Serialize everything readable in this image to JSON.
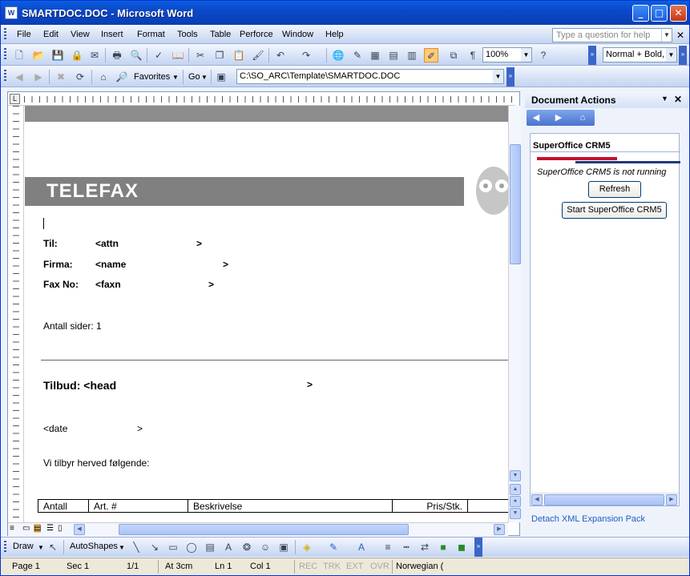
{
  "window": {
    "title": "SMARTDOC.DOC - Microsoft Word"
  },
  "menu": {
    "items": [
      "File",
      "Edit",
      "View",
      "Insert",
      "Format",
      "Tools",
      "Table",
      "Perforce",
      "Window",
      "Help"
    ],
    "ask_placeholder": "Type a question for help"
  },
  "toolbar": {
    "zoom": "100%",
    "style": "Normal + Bold,"
  },
  "web": {
    "favorites": "Favorites",
    "go": "Go",
    "address": "C:\\SO_ARC\\Template\\SMARTDOC.DOC"
  },
  "doc": {
    "banner": "TELEFAX",
    "til_label": "Til:",
    "til_value": "<attn",
    "til_close": ">",
    "firma_label": "Firma:",
    "firma_value": "<name",
    "firma_close": ">",
    "fax_label": "Fax No:",
    "fax_value": "<faxn",
    "fax_close": ">",
    "pages": "Antall sider: 1",
    "tilbud": "Tilbud: <head",
    "tilbud_close": ">",
    "date": "<date",
    "date_close": ">",
    "offer": "Vi tilbyr herved følgende:",
    "table_headers": [
      "Antall",
      "Art. #",
      "Beskrivelse",
      "Pris/Stk."
    ]
  },
  "pane": {
    "title": "Document Actions",
    "crm_title": "SuperOffice CRM5",
    "status": "SuperOffice CRM5 is not running",
    "refresh": "Refresh",
    "start": "Start SuperOffice CRM5",
    "detach": "Detach XML Expansion Pack"
  },
  "draw": {
    "draw": "Draw",
    "autoshapes": "AutoShapes"
  },
  "status": {
    "page": "Page 1",
    "sec": "Sec 1",
    "pages": "1/1",
    "at": "At 3cm",
    "ln": "Ln 1",
    "col": "Col 1",
    "rec": "REC",
    "trk": "TRK",
    "ext": "EXT",
    "ovr": "OVR",
    "lang": "Norwegian ("
  }
}
